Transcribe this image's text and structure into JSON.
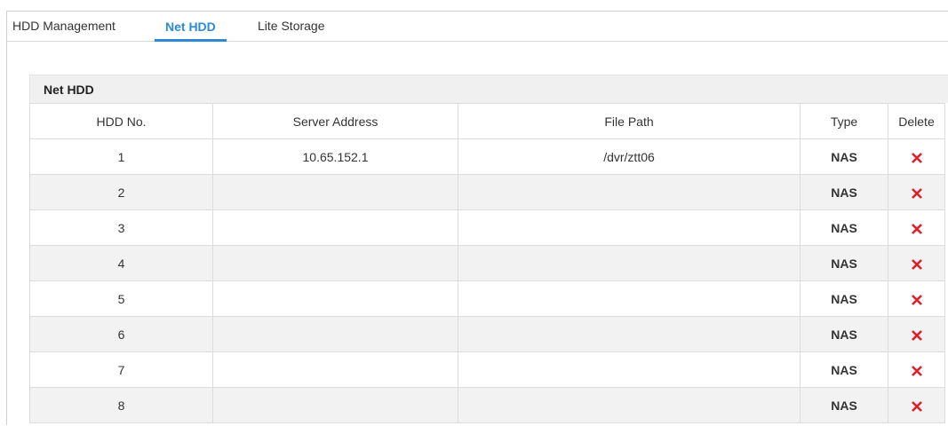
{
  "tabs": [
    {
      "label": "HDD Management",
      "active": false
    },
    {
      "label": "Net HDD",
      "active": true
    },
    {
      "label": "Lite Storage",
      "active": false
    }
  ],
  "panel": {
    "title": "Net HDD"
  },
  "table": {
    "columns": [
      "HDD No.",
      "Server Address",
      "File Path",
      "Type",
      "Delete"
    ],
    "rows": [
      {
        "no": "1",
        "server": "10.65.152.1",
        "path": "/dvr/ztt06",
        "type": "NAS"
      },
      {
        "no": "2",
        "server": "",
        "path": "",
        "type": "NAS"
      },
      {
        "no": "3",
        "server": "",
        "path": "",
        "type": "NAS"
      },
      {
        "no": "4",
        "server": "",
        "path": "",
        "type": "NAS"
      },
      {
        "no": "5",
        "server": "",
        "path": "",
        "type": "NAS"
      },
      {
        "no": "6",
        "server": "",
        "path": "",
        "type": "NAS"
      },
      {
        "no": "7",
        "server": "",
        "path": "",
        "type": "NAS"
      },
      {
        "no": "8",
        "server": "",
        "path": "",
        "type": "NAS"
      }
    ]
  },
  "icons": {
    "delete": "close-icon"
  },
  "colors": {
    "accent": "#2d8ad6",
    "delete": "#e0202a"
  }
}
